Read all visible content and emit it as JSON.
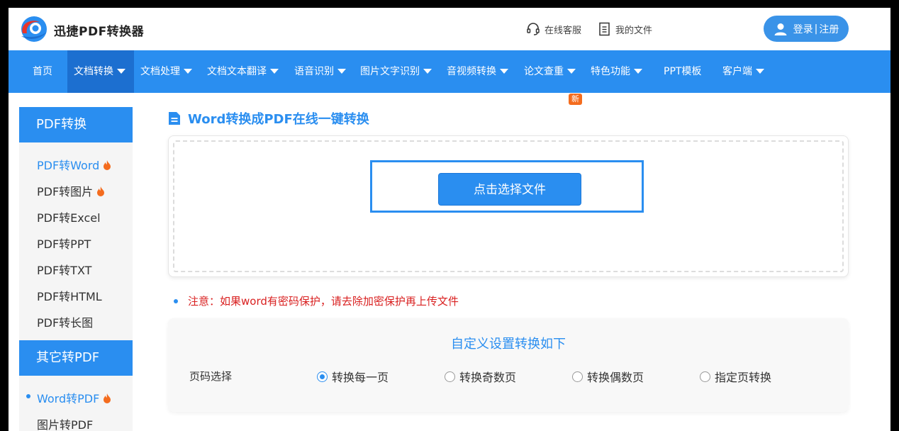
{
  "header": {
    "brand": "迅捷PDF转换器",
    "service_label": "在线客服",
    "files_label": "我的文件",
    "login_label": "登录",
    "register_label": "注册",
    "divider": "|"
  },
  "nav": {
    "home": "首页",
    "doc_convert": "文档转换",
    "doc_process": "文档处理",
    "doc_translate": "文档文本翻译",
    "speech": "语音识别",
    "image_text": "图片文字识别",
    "av_convert": "音视频转换",
    "paper_check": "论文查重",
    "new_badge": "新",
    "features": "特色功能",
    "ppt": "PPT模板",
    "client": "客户端"
  },
  "sidebar": {
    "pdf_head": "PDF转换",
    "pdf_items": [
      "PDF转Word",
      "PDF转图片",
      "PDF转Excel",
      "PDF转PPT",
      "PDF转TXT",
      "PDF转HTML",
      "PDF转长图"
    ],
    "other_head": "其它转PDF",
    "other_items": [
      "Word转PDF",
      "图片转PDF"
    ]
  },
  "main": {
    "title": "Word转换成PDF在线一键转换",
    "select_button": "点击选择文件",
    "notice": "注意：如果word有密码保护，请去除加密保护再上传文件",
    "settings_title": "自定义设置转换如下",
    "page_label": "页码选择",
    "options": [
      "转换每一页",
      "转换奇数页",
      "转换偶数页",
      "指定页转换"
    ],
    "selected_option": "转换每一页"
  },
  "colors": {
    "accent": "#2a8ef0",
    "nav_active": "#1c6fd0",
    "warning": "#d92020",
    "badge": "#f46c1e"
  }
}
